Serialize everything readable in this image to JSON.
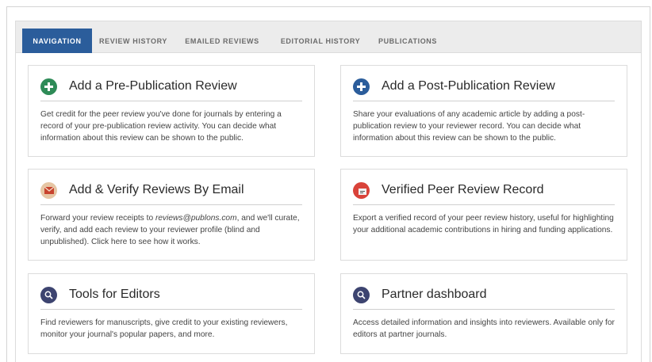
{
  "tabs": [
    {
      "label": "NAVIGATION",
      "active": true
    },
    {
      "label": "REVIEW HISTORY",
      "active": false
    },
    {
      "label": "EMAILED REVIEWS",
      "active": false
    },
    {
      "label": "EDITORIAL HISTORY",
      "active": false
    },
    {
      "label": "PUBLICATIONS",
      "active": false
    }
  ],
  "cards": {
    "pre_review": {
      "title": "Add a Pre-Publication Review",
      "icon": "plus-circle-icon",
      "icon_color": "#2e8b57",
      "text": "Get credit for the peer review you've done for journals by entering a record of your pre-publication review activity. You can decide what information about this review can be shown to the public."
    },
    "post_review": {
      "title": "Add a Post-Publication Review",
      "icon": "plus-circle-icon",
      "icon_color": "#2b5d9b",
      "text": "Share your evaluations of any academic article by adding a post-publication review to your reviewer record. You can decide what information about this review can be shown to the public."
    },
    "email_reviews": {
      "title": "Add & Verify Reviews By Email",
      "icon": "envelope-icon",
      "icon_color": "#e0b48a",
      "text_before": "Forward your review receipts to ",
      "email": "reviews@publons.com",
      "text_after": ", and we'll curate, verify, and add each review to your reviewer profile (blind and unpublished). Click here to see how it works."
    },
    "verified_record": {
      "title": "Verified Peer Review Record",
      "icon": "certificate-icon",
      "icon_color": "#d9433a",
      "text": "Export a verified record of your peer review history, useful for highlighting your additional academic contributions in hiring and funding applications."
    },
    "editor_tools": {
      "title": "Tools for Editors",
      "icon": "search-icon",
      "icon_color": "#3d4470",
      "text": "Find reviewers for manuscripts, give credit to your existing reviewers, monitor your journal's popular papers, and more."
    },
    "partner_dashboard": {
      "title": "Partner dashboard",
      "icon": "search-icon",
      "icon_color": "#3d4470",
      "text": "Access detailed information and insights into reviewers. Available only for editors at partner journals."
    }
  }
}
